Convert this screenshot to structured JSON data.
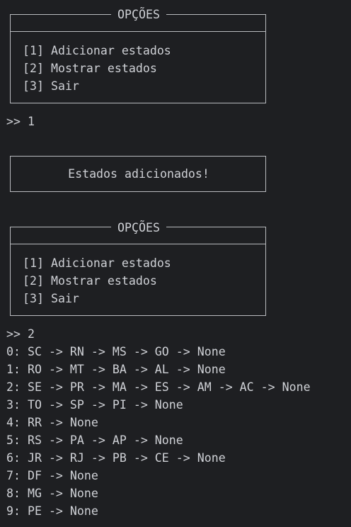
{
  "menu1": {
    "title": "OPÇÕES",
    "items": [
      "[1] Adicionar estados",
      "[2] Mostrar estados",
      "[3] Sair"
    ]
  },
  "prompt1": ">> 1",
  "message_box": {
    "text": "Estados adicionados!"
  },
  "menu2": {
    "title": "OPÇÕES",
    "items": [
      "[1] Adicionar estados",
      "[2] Mostrar estados",
      "[3] Sair"
    ]
  },
  "prompt2": ">> 2",
  "output_lines": [
    "0: SC -> RN -> MS -> GO -> None",
    "1: RO -> MT -> BA -> AL -> None",
    "2: SE -> PR -> MA -> ES -> AM -> AC -> None",
    "3: TO -> SP -> PI -> None",
    "4: RR -> None",
    "5: RS -> PA -> AP -> None",
    "6: JR -> RJ -> PB -> CE -> None",
    "7: DF -> None",
    "8: MG -> None",
    "9: PE -> None"
  ]
}
